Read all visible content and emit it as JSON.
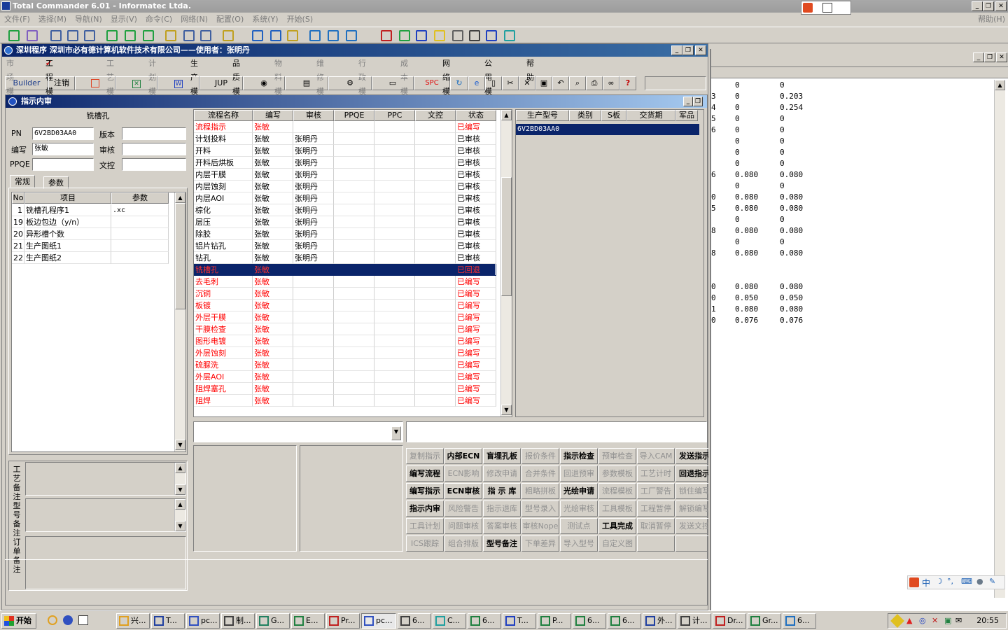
{
  "tc": {
    "title": "Total Commander 6.01 - Informatec Ltda.",
    "menu": [
      "文件(F)",
      "选择(M)",
      "导航(N)",
      "显示(V)",
      "命令(C)",
      "网络(N)",
      "配置(O)",
      "系统(Y)",
      "开始(S)"
    ],
    "help": "帮助(H)"
  },
  "app": {
    "title": "深圳程序    深圳市必有德计算机软件技术有限公司——使用者：张明丹",
    "menu": [
      "市场模块",
      "工程模块",
      "工艺模块",
      "计划模块",
      "生产模块",
      "品质模块",
      "物料模块",
      "维修模块",
      "行政模块",
      "成本模块",
      "网络模块",
      "公用模块",
      "帮助"
    ],
    "toolbar": {
      "builder": "Builder",
      "logout": "注销",
      "jup": "JUP",
      "spc": "SPC"
    }
  },
  "inner": {
    "title": "指示内审",
    "header": "铣槽孔",
    "fields": {
      "pn_label": "PN",
      "pn": "6V2BD03AA0",
      "version_label": "版本",
      "version": "",
      "editor_label": "编写",
      "editor": "张敏",
      "review_label": "审核",
      "review": "",
      "ppqe_label": "PPQE",
      "ppqe": "",
      "doc_label": "文控",
      "doc": ""
    },
    "tabs": [
      "常规",
      "参数"
    ],
    "param_headers": [
      "No",
      "项目",
      "参数"
    ],
    "params": [
      {
        "no": "1",
        "item": "铣槽孔程序1",
        "val": ".xc"
      },
      {
        "no": "19",
        "item": "板边包边（y/n）",
        "val": ""
      },
      {
        "no": "20",
        "item": "异形槽个数",
        "val": ""
      },
      {
        "no": "21",
        "item": "生产图纸1",
        "val": ""
      },
      {
        "no": "22",
        "item": "生产图纸2",
        "val": ""
      }
    ],
    "notes_labels": [
      "工艺备注",
      "型号备注",
      "订单备注"
    ],
    "flow_headers": [
      "流程名称",
      "编写",
      "审核",
      "PPQE",
      "PPC",
      "文控",
      "状态"
    ],
    "flow": [
      {
        "name": "流程指示",
        "w": "张敏",
        "r": "",
        "s": "已编写",
        "red": true
      },
      {
        "name": "计划投料",
        "w": "张敏",
        "r": "张明丹",
        "s": "已审核",
        "red": false
      },
      {
        "name": "开料",
        "w": "张敏",
        "r": "张明丹",
        "s": "已审核",
        "red": false
      },
      {
        "name": "开料后烘板",
        "w": "张敏",
        "r": "张明丹",
        "s": "已审核",
        "red": false
      },
      {
        "name": "内层干膜",
        "w": "张敏",
        "r": "张明丹",
        "s": "已审核",
        "red": false
      },
      {
        "name": "内层蚀刻",
        "w": "张敏",
        "r": "张明丹",
        "s": "已审核",
        "red": false
      },
      {
        "name": "内层AOI",
        "w": "张敏",
        "r": "张明丹",
        "s": "已审核",
        "red": false
      },
      {
        "name": "棕化",
        "w": "张敏",
        "r": "张明丹",
        "s": "已审核",
        "red": false
      },
      {
        "name": "层压",
        "w": "张敏",
        "r": "张明丹",
        "s": "已审核",
        "red": false
      },
      {
        "name": "除胶",
        "w": "张敏",
        "r": "张明丹",
        "s": "已审核",
        "red": false
      },
      {
        "name": "铝片钻孔",
        "w": "张敏",
        "r": "张明丹",
        "s": "已审核",
        "red": false
      },
      {
        "name": "钻孔",
        "w": "张敏",
        "r": "张明丹",
        "s": "已审核",
        "red": false
      },
      {
        "name": "铣槽孔",
        "w": "张敏",
        "r": "",
        "s": "已回退",
        "red": true,
        "sel": true
      },
      {
        "name": "去毛刺",
        "w": "张敏",
        "r": "",
        "s": "已编写",
        "red": true
      },
      {
        "name": "沉铜",
        "w": "张敏",
        "r": "",
        "s": "已编写",
        "red": true
      },
      {
        "name": "板镀",
        "w": "张敏",
        "r": "",
        "s": "已编写",
        "red": true
      },
      {
        "name": "外层干膜",
        "w": "张敏",
        "r": "",
        "s": "已编写",
        "red": true
      },
      {
        "name": "干膜检查",
        "w": "张敏",
        "r": "",
        "s": "已编写",
        "red": true
      },
      {
        "name": "图形电镀",
        "w": "张敏",
        "r": "",
        "s": "已编写",
        "red": true
      },
      {
        "name": "外层蚀刻",
        "w": "张敏",
        "r": "",
        "s": "已编写",
        "red": true
      },
      {
        "name": "硫脲洗",
        "w": "张敏",
        "r": "",
        "s": "已编写",
        "red": true
      },
      {
        "name": "外层AOI",
        "w": "张敏",
        "r": "",
        "s": "已编写",
        "red": true
      },
      {
        "name": "阻焊塞孔",
        "w": "张敏",
        "r": "",
        "s": "已编写",
        "red": true
      },
      {
        "name": "阻焊",
        "w": "张敏",
        "r": "",
        "s": "已编写",
        "red": true
      }
    ],
    "model_headers": [
      "生产型号",
      "类别",
      "S板",
      "交货期",
      "军品"
    ],
    "models": [
      {
        "model": "6V2BD03AA0"
      }
    ],
    "buttons": [
      [
        "复制指示",
        "内部ECN",
        "盲埋孔板",
        "报价条件",
        "指示检查",
        "预审检查",
        "导入CAM",
        "发送指示"
      ],
      [
        "编写流程",
        "ECN影响",
        "修改申请",
        "合并条件",
        "回退预审",
        "参数模板",
        "工艺计时",
        "回退指示"
      ],
      [
        "编写指示",
        "ECN审核",
        "指 示 库",
        "粗略拼板",
        "光绘申请",
        "流程模板",
        "工厂警告",
        "锁住编写"
      ],
      [
        "指示内审",
        "风险警告",
        "指示退库",
        "型号录入",
        "光绘审核",
        "工具模板",
        "工程暂停",
        "解锁编写"
      ],
      [
        "工具计划",
        "问题审核",
        "答案审核",
        "审核Nope",
        "测试点",
        "工具完成",
        "取消暂停",
        "发送文控"
      ],
      [
        "ICS跟踪",
        "组合排版",
        "型号备注",
        "下单差异",
        "导入型号",
        "自定义图",
        "",
        ""
      ]
    ],
    "buttons_enabled": [
      [
        false,
        true,
        true,
        false,
        true,
        false,
        false,
        true
      ],
      [
        true,
        false,
        false,
        false,
        false,
        false,
        false,
        true
      ],
      [
        true,
        true,
        true,
        false,
        true,
        false,
        false,
        false
      ],
      [
        true,
        false,
        false,
        false,
        false,
        false,
        false,
        false
      ],
      [
        false,
        false,
        false,
        false,
        false,
        true,
        false,
        false
      ],
      [
        false,
        false,
        true,
        false,
        false,
        false,
        false,
        false
      ]
    ]
  },
  "viewer": {
    "lines": [
      [
        "",
        "0",
        "0"
      ],
      [
        "3",
        "0",
        "0.203"
      ],
      [
        "4",
        "0",
        "0.254"
      ],
      [
        "5",
        "0",
        "0"
      ],
      [
        "6",
        "0",
        "0"
      ],
      [
        "",
        "0",
        "0"
      ],
      [
        "",
        "0",
        "0"
      ],
      [
        "",
        "0",
        "0"
      ],
      [
        "6",
        "0.080",
        "0.080"
      ],
      [
        "",
        "0",
        "0"
      ],
      [
        "0",
        "0.080",
        "0.080"
      ],
      [
        "5",
        "0.080",
        "0.080"
      ],
      [
        "",
        "0",
        "0"
      ],
      [
        "8",
        "0.080",
        "0.080"
      ],
      [
        "",
        "0",
        "0"
      ],
      [
        "8",
        "0.080",
        "0.080"
      ],
      [
        "",
        "",
        ""
      ],
      [
        "",
        "",
        ""
      ],
      [
        "0",
        "0.080",
        "0.080"
      ],
      [
        "0",
        "0.050",
        "0.050"
      ],
      [
        "1",
        "0.080",
        "0.080"
      ],
      [
        "0",
        "0.076",
        "0.076"
      ]
    ]
  },
  "taskbar": {
    "start": "开始",
    "tasks": [
      "兴...",
      "T...",
      "pc...",
      "制...",
      "G...",
      "E...",
      "Pr...",
      "pc...",
      "6...",
      "C...",
      "6...",
      "T...",
      "P...",
      "6...",
      "6...",
      "外...",
      "计...",
      "Dr...",
      "Gr...",
      "6..."
    ],
    "clock": "20:55"
  }
}
